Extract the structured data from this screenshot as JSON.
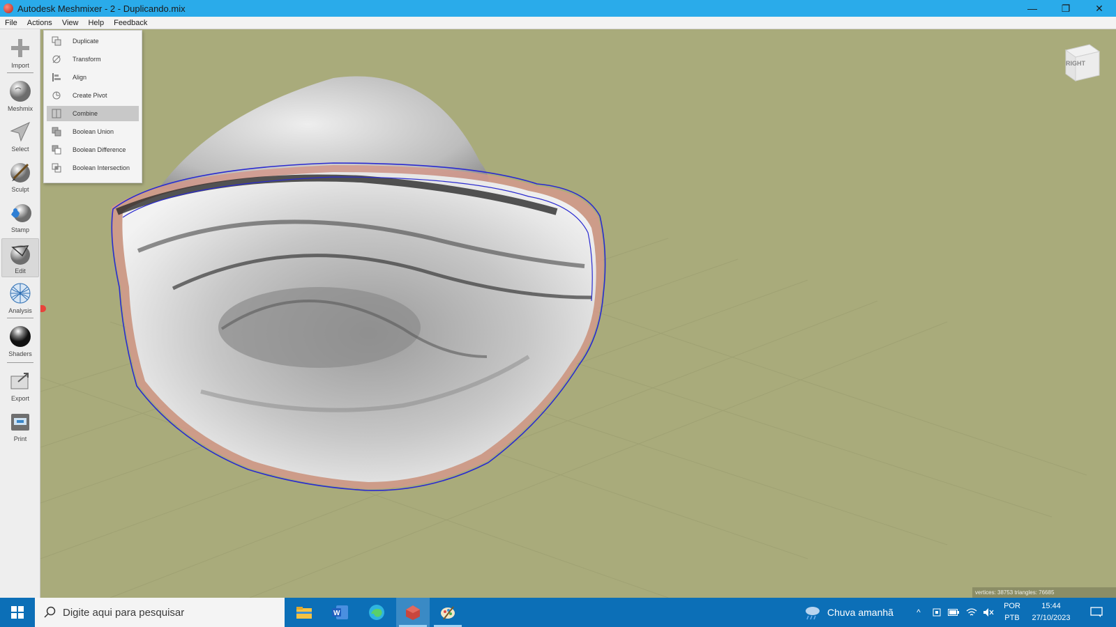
{
  "window": {
    "title": "Autodesk Meshmixer - 2 - Duplicando.mix",
    "minimize": "—",
    "restore": "❐",
    "close": "✕"
  },
  "menubar": {
    "items": [
      "File",
      "Actions",
      "View",
      "Help",
      "Feedback"
    ]
  },
  "toolbar": {
    "tools": [
      {
        "label": "Import",
        "icon": "plus-icon"
      },
      {
        "label": "Meshmix",
        "icon": "meshmix-sphere-icon"
      },
      {
        "label": "Select",
        "icon": "select-arrow-icon"
      },
      {
        "label": "Sculpt",
        "icon": "sculpt-brush-icon"
      },
      {
        "label": "Stamp",
        "icon": "stamp-icon"
      },
      {
        "label": "Edit",
        "icon": "edit-sphere-icon",
        "active": true
      },
      {
        "label": "Analysis",
        "icon": "analysis-globe-icon"
      },
      {
        "label": "Shaders",
        "icon": "shaders-sphere-icon"
      },
      {
        "label": "Export",
        "icon": "export-icon"
      },
      {
        "label": "Print",
        "icon": "print-icon"
      }
    ]
  },
  "actions_menu": {
    "items": [
      {
        "label": "Duplicate",
        "icon": "duplicate-icon"
      },
      {
        "label": "Transform",
        "icon": "transform-icon"
      },
      {
        "label": "Align",
        "icon": "align-icon"
      },
      {
        "label": "Create Pivot",
        "icon": "pivot-icon"
      },
      {
        "label": "Combine",
        "icon": "combine-icon",
        "highlighted": true
      },
      {
        "label": "Boolean Union",
        "icon": "boolean-union-icon"
      },
      {
        "label": "Boolean Difference",
        "icon": "boolean-difference-icon"
      },
      {
        "label": "Boolean Intersection",
        "icon": "boolean-intersection-icon"
      }
    ]
  },
  "viewcube": {
    "face_label": "RIGHT"
  },
  "stats": {
    "text": "vertices: 38753 triangles: 76685"
  },
  "colors": {
    "viewport_bg": "#a9ab7b",
    "titlebar": "#2aabea",
    "taskbar": "#0c6fb7",
    "selection_outline": "#2a2ad0",
    "selection_fill": "#d3998c"
  },
  "taskbar": {
    "search_placeholder": "Digite aqui para pesquisar",
    "apps": [
      "file-explorer-icon",
      "word-icon",
      "edge-icon",
      "meshmixer-icon",
      "paint-icon"
    ],
    "weather": "Chuva amanhã",
    "lang_top": "POR",
    "lang_bottom": "PTB",
    "time": "15:44",
    "date": "27/10/2023"
  }
}
